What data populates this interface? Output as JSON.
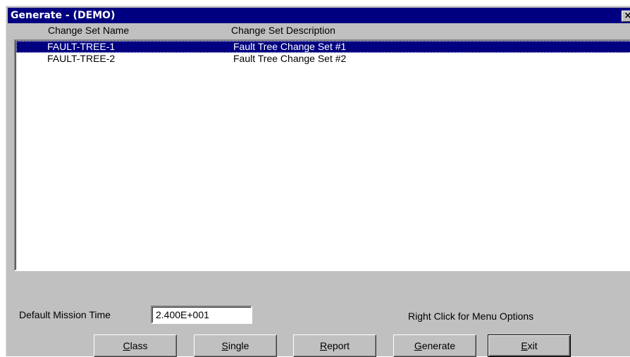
{
  "window": {
    "title": "Generate  -  (DEMO)",
    "close_glyph": "×"
  },
  "list": {
    "columns": [
      "Change Set Name",
      "Change Set Description"
    ],
    "rows": [
      {
        "name": "FAULT-TREE-1",
        "description": "Fault Tree Change Set #1",
        "selected": true
      },
      {
        "name": "FAULT-TREE-2",
        "description": "Fault Tree Change Set #2",
        "selected": false
      }
    ]
  },
  "mission": {
    "label": "Default Mission Time",
    "value": "2.400E+001"
  },
  "hint": "Right Click for Menu Options",
  "buttons": {
    "class": {
      "accel": "C",
      "rest": "lass"
    },
    "single": {
      "accel": "S",
      "rest": "ingle"
    },
    "report": {
      "accel": "R",
      "rest": "eport"
    },
    "generate": {
      "accel": "G",
      "rest": "enerate"
    },
    "exit": {
      "accel": "E",
      "rest": "xit"
    }
  },
  "colors": {
    "titlebar": "#000080",
    "selection": "#000080",
    "face": "#c0c0c0"
  }
}
